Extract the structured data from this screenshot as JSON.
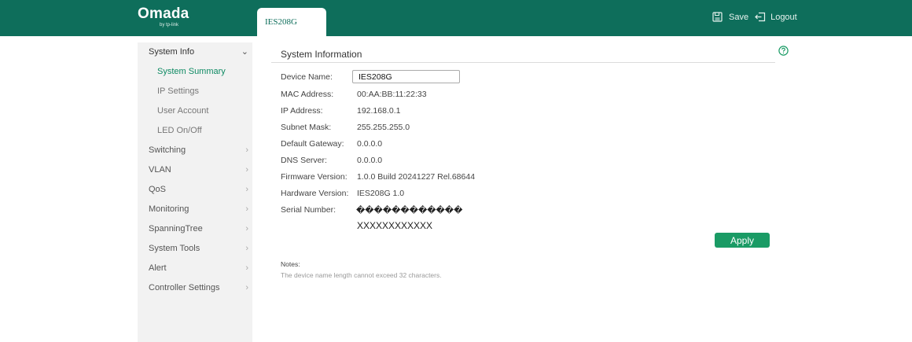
{
  "header": {
    "brand": "Omada",
    "brand_sub": "by tp-link",
    "device_tab": "IES208G",
    "save_label": "Save",
    "logout_label": "Logout"
  },
  "sidebar": {
    "items": [
      {
        "label": "System Info",
        "expanded": true
      },
      {
        "label": "System Summary",
        "active": true
      },
      {
        "label": "IP Settings"
      },
      {
        "label": "User Account"
      },
      {
        "label": "LED On/Off"
      },
      {
        "label": "Switching"
      },
      {
        "label": "VLAN"
      },
      {
        "label": "QoS"
      },
      {
        "label": "Monitoring"
      },
      {
        "label": "SpanningTree"
      },
      {
        "label": "System Tools"
      },
      {
        "label": "Alert"
      },
      {
        "label": "Controller Settings"
      }
    ]
  },
  "main": {
    "title": "System Information",
    "fields": [
      {
        "label": "Device Name:",
        "value": "IES208G"
      },
      {
        "label": "MAC Address:",
        "value": "00:AA:BB:11:22:33"
      },
      {
        "label": "IP Address:",
        "value": "192.168.0.1"
      },
      {
        "label": "Subnet Mask:",
        "value": "255.255.255.0"
      },
      {
        "label": "Default Gateway:",
        "value": "0.0.0.0"
      },
      {
        "label": "DNS Server:",
        "value": "0.0.0.0"
      },
      {
        "label": "Firmware Version:",
        "value": "1.0.0 Build 20241227 Rel.68644"
      },
      {
        "label": "Hardware Version:",
        "value": "IES208G 1.0"
      },
      {
        "label": "Serial Number:",
        "value": "������������"
      }
    ],
    "serial_extra": "XXXXXXXXXXXX",
    "apply_label": "Apply",
    "notes_label": "Notes:",
    "notes_text": "The device name length cannot exceed 32 characters."
  },
  "colors": {
    "header_bg": "#0e6e5b",
    "accent": "#1a9b65",
    "active_nav": "#0e8a63",
    "sidebar_bg": "#f2f2f2"
  },
  "icons": {
    "save": "save-icon",
    "logout": "logout-icon",
    "help": "help-icon"
  }
}
